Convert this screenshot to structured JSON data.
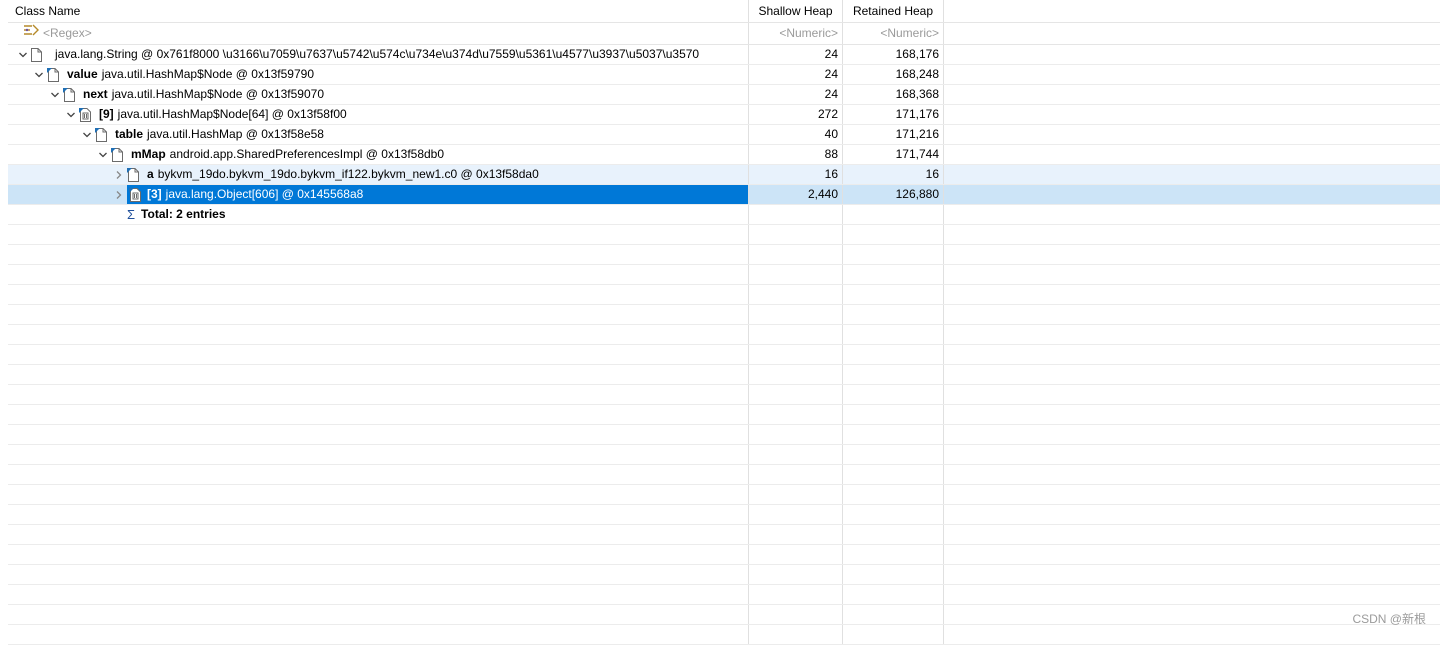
{
  "columns": {
    "class_name": "Class Name",
    "shallow_heap": "Shallow Heap",
    "retained_heap": "Retained Heap"
  },
  "filters": {
    "class_name": "<Regex>",
    "shallow_heap": "<Numeric>",
    "retained_heap": "<Numeric>"
  },
  "icons": {
    "filter": "regex-filter-icon",
    "object": "object-icon",
    "array": "array-icon",
    "sum": "sum-icon"
  },
  "colors": {
    "selection": "#0078d7",
    "row_selected": "#cce4f7",
    "row_hover": "#e8f2fc"
  },
  "rows": [
    {
      "kw": "",
      "text": "java.lang.String @ 0x761f8000  \\u3166\\u7059\\u7637\\u5742\\u574c\\u734e\\u374d\\u7559\\u5361\\u4577\\u3937\\u5037\\u3570",
      "shallow": "24",
      "retained": "168,176"
    },
    {
      "kw": "value",
      "text": "java.util.HashMap$Node @ 0x13f59790",
      "shallow": "24",
      "retained": "168,248"
    },
    {
      "kw": "next",
      "text": "java.util.HashMap$Node @ 0x13f59070",
      "shallow": "24",
      "retained": "168,368"
    },
    {
      "kw": "[9]",
      "text": "java.util.HashMap$Node[64] @ 0x13f58f00",
      "shallow": "272",
      "retained": "171,176"
    },
    {
      "kw": "table",
      "text": "java.util.HashMap @ 0x13f58e58",
      "shallow": "40",
      "retained": "171,216"
    },
    {
      "kw": "mMap",
      "text": "android.app.SharedPreferencesImpl @ 0x13f58db0",
      "shallow": "88",
      "retained": "171,744"
    },
    {
      "kw": "a",
      "text": "bykvm_19do.bykvm_19do.bykvm_if122.bykvm_new1.c0 @ 0x13f58da0",
      "shallow": "16",
      "retained": "16"
    },
    {
      "kw": "[3]",
      "text": "java.lang.Object[606] @ 0x145568a8",
      "shallow": "2,440",
      "retained": "126,880"
    }
  ],
  "total": "Total: 2 entries",
  "watermark": "CSDN @新根"
}
